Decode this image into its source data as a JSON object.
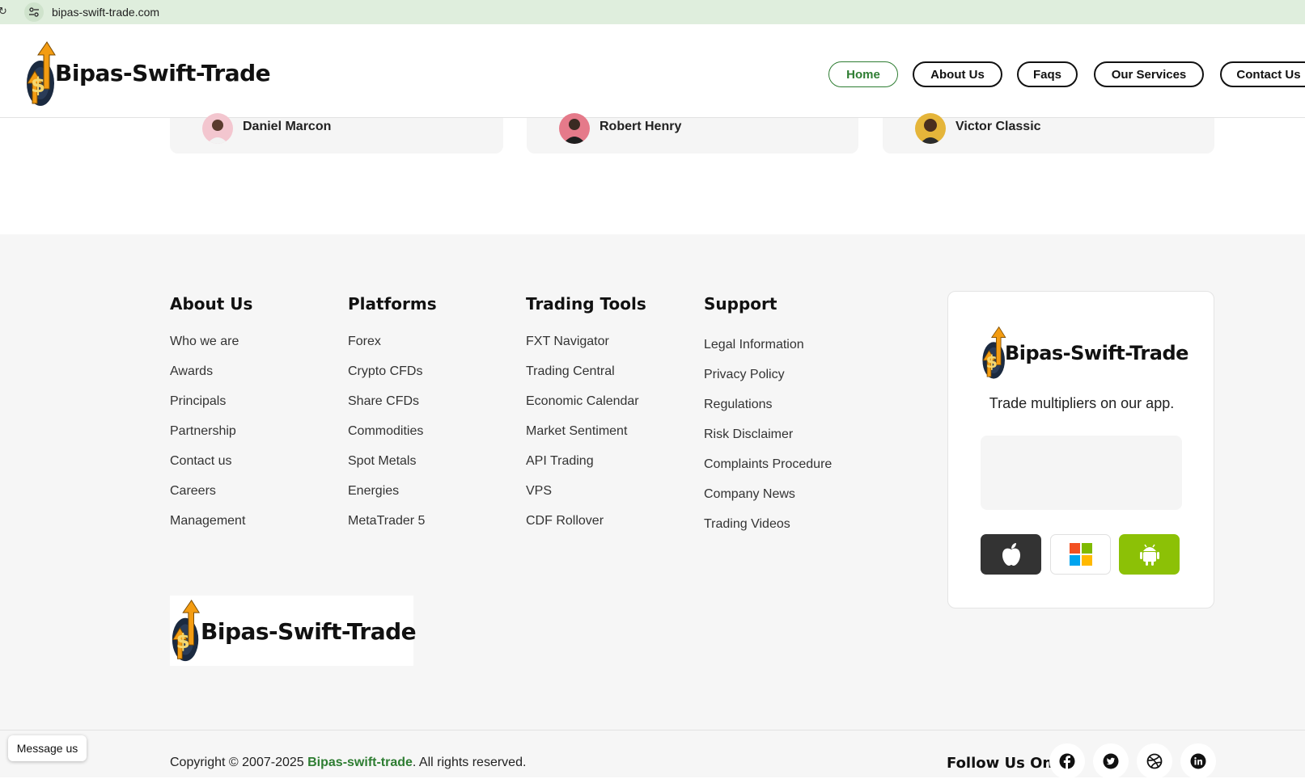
{
  "browser": {
    "url": "bipas-swift-trade.com"
  },
  "header": {
    "logo_text": "Bipas-Swift-Trade",
    "nav": [
      {
        "label": "Home",
        "active": true
      },
      {
        "label": "About Us"
      },
      {
        "label": "Faqs"
      },
      {
        "label": "Our Services"
      },
      {
        "label": "Contact Us"
      }
    ]
  },
  "testimonials": [
    {
      "name": "Daniel Marcon"
    },
    {
      "name": "Robert Henry"
    },
    {
      "name": "Victor Classic"
    }
  ],
  "footer": {
    "columns": [
      {
        "title": "About Us",
        "links": [
          "Who we are",
          "Awards",
          "Principals",
          "Partnership",
          "Contact us",
          "Careers",
          "Management"
        ]
      },
      {
        "title": "Platforms",
        "links": [
          "Forex",
          "Crypto CFDs",
          "Share CFDs",
          "Commodities",
          "Spot Metals",
          "Energies",
          "MetaTrader 5"
        ]
      },
      {
        "title": "Trading Tools",
        "links": [
          "FXT Navigator",
          "Trading Central",
          "Economic Calendar",
          "Market Sentiment",
          "API Trading",
          "VPS",
          "CDF Rollover"
        ]
      },
      {
        "title": "Support",
        "links": [
          "Legal Information",
          "Privacy Policy",
          "Regulations",
          "Risk Disclaimer",
          "Complaints Procedure",
          "Company News",
          "Trading Videos"
        ]
      }
    ],
    "app_card": {
      "logo_text": "Bipas-Swift-Trade",
      "tagline": "Trade multipliers on our app.",
      "stores": [
        {
          "icon": "apple-icon"
        },
        {
          "icon": "windows-icon"
        },
        {
          "icon": "android-icon"
        }
      ]
    },
    "logo_text": "Bipas-Swift-Trade",
    "copyright_prefix": "Copyright © 2007-2025 ",
    "copyright_brand": "Bipas-swift-trade",
    "copyright_suffix": ". All rights reserved.",
    "follow_label": "Follow Us On:",
    "socials": [
      "facebook-icon",
      "twitter-icon",
      "dribbble-icon",
      "linkedin-icon"
    ]
  },
  "chat": {
    "label": "Message us"
  },
  "colors": {
    "brand_green": "#2e7d32",
    "android_green": "#8cc106",
    "apple_dark": "#333333",
    "footer_bg": "#f6f6f6"
  }
}
